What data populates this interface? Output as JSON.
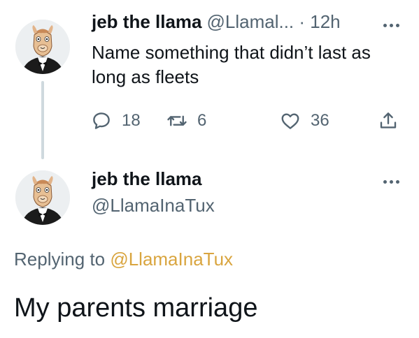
{
  "colors": {
    "text_primary": "#0f1419",
    "text_secondary": "#536471",
    "mention": "#d9a53f",
    "thread_line": "#cfd9de"
  },
  "parent_tweet": {
    "display_name": "jeb the llama",
    "handle_time": "@Llamal... · 12h",
    "text": "Name something that didn’t last as long as fleets",
    "reply_count": "18",
    "retweet_count": "6",
    "like_count": "36",
    "icons": {
      "reply": "reply-bubble-icon",
      "retweet": "retweet-icon",
      "like": "heart-icon",
      "share": "share-upload-icon",
      "more": "more-dots-icon"
    }
  },
  "reply_tweet": {
    "display_name": "jeb the llama",
    "handle": "@LlamaInaTux",
    "replying_prefix": "Replying to",
    "replying_to": "@LlamaInaTux",
    "text": "My parents marriage"
  }
}
